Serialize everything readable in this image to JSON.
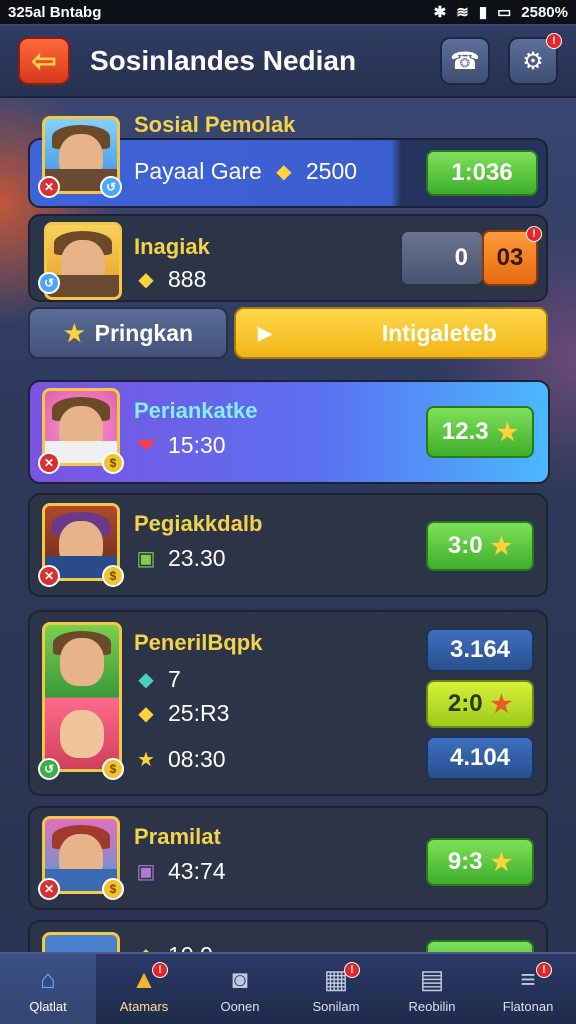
{
  "status_bar": {
    "left": "325al Bntabg",
    "battery": "2580%"
  },
  "header": {
    "title": "Sosinlandes Nedian",
    "settings_badge": "!"
  },
  "cards": [
    {
      "title": "Sosial Pemolak",
      "stat": "Payaal Gare",
      "stat_value": "2500",
      "right": "1:036"
    },
    {
      "title": "Inagiak",
      "stat": "888",
      "score_left": "0",
      "score_right": "03",
      "score_badge": "!"
    },
    {
      "title": "Periankatke",
      "stat": "15:30",
      "right": "12.3"
    },
    {
      "title": "Pegiakkdalb",
      "stat": "23.30",
      "right": "3:0"
    },
    {
      "title": "PenerilBqpk",
      "stat1": "7",
      "stat2": "25:R3",
      "stat3": "08:30",
      "right1": "3.164",
      "right2": "2:0",
      "right3": "4.104"
    },
    {
      "title": "Pramilat",
      "stat": "43:74",
      "right": "9:3"
    }
  ],
  "tabs": {
    "left": "Pringkan",
    "right": "Intigaleteb"
  },
  "nav": [
    {
      "label": "Qlatlat",
      "badge": ""
    },
    {
      "label": "Atamars",
      "badge": "!"
    },
    {
      "label": "Oonen",
      "badge": ""
    },
    {
      "label": "Sonilam",
      "badge": "!"
    },
    {
      "label": "Reobilin",
      "badge": ""
    },
    {
      "label": "Flatonan",
      "badge": "!"
    }
  ],
  "partial_row": {
    "stat": "10.0"
  }
}
